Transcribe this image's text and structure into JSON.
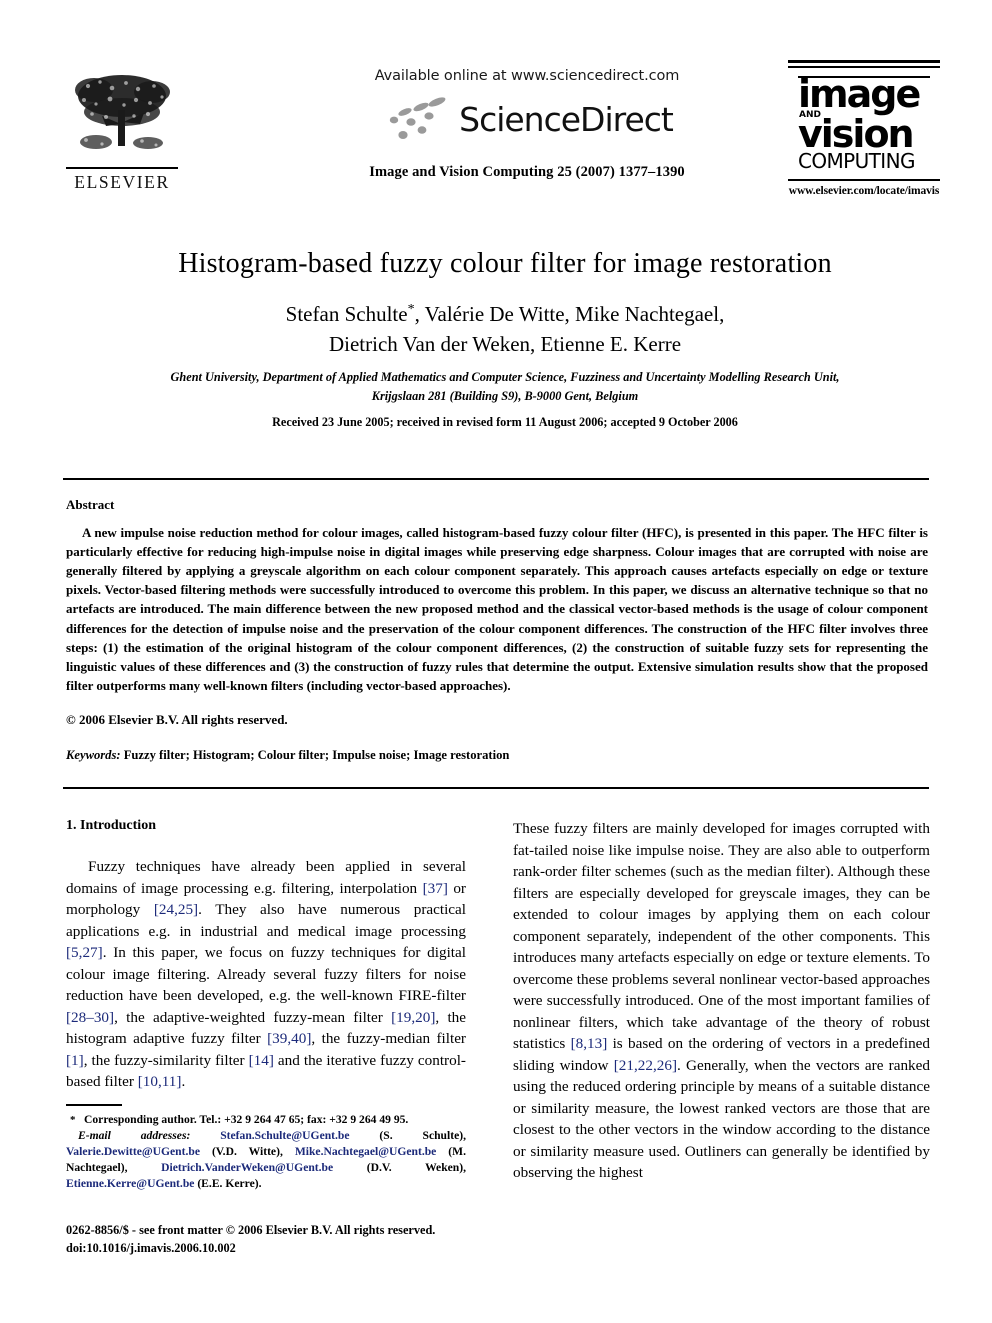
{
  "header": {
    "elsevier_logo_label": "ELSEVIER",
    "available_online": "Available online at www.sciencedirect.com",
    "sciencedirect_wordmark": "ScienceDirect",
    "journal_reference": "Image and Vision Computing 25 (2007) 1377–1390",
    "journal_logo": {
      "line1": "image",
      "line2": "AND",
      "line3": "vision",
      "line4": "COMPUTING"
    },
    "journal_url": "www.elsevier.com/locate/imavis"
  },
  "article": {
    "title": "Histogram-based fuzzy colour filter for image restoration",
    "authors_line1": "Stefan Schulte",
    "authors_line1_rest": ", Valérie De Witte, Mike Nachtegael,",
    "authors_line2": "Dietrich Van der Weken, Etienne E. Kerre",
    "corresponding_marker": "*",
    "affiliation_line1": "Ghent University, Department of Applied Mathematics and Computer Science, Fuzziness and Uncertainty Modelling Research Unit,",
    "affiliation_line2": "Krijgslaan 281 (Building S9), B-9000 Gent, Belgium",
    "history": "Received 23 June 2005; received in revised form 11 August 2006; accepted 9 October 2006"
  },
  "abstract": {
    "heading": "Abstract",
    "body": "A new impulse noise reduction method for colour images, called histogram-based fuzzy colour filter (HFC), is presented in this paper. The HFC filter is particularly effective for reducing high-impulse noise in digital images while preserving edge sharpness. Colour images that are corrupted with noise are generally filtered by applying a greyscale algorithm on each colour component separately. This approach causes artefacts especially on edge or texture pixels. Vector-based filtering methods were successfully introduced to overcome this problem. In this paper, we discuss an alternative technique so that no artefacts are introduced. The main difference between the new proposed method and the classical vector-based methods is the usage of colour component differences for the detection of impulse noise and the preservation of the colour component differences. The construction of the HFC filter involves three steps: (1) the estimation of the original histogram of the colour component differences, (2) the construction of suitable fuzzy sets for representing the linguistic values of these differences and (3) the construction of fuzzy rules that determine the output. Extensive simulation results show that the proposed filter outperforms many well-known filters (including vector-based approaches).",
    "copyright": "© 2006 Elsevier B.V. All rights reserved.",
    "keywords_label": "Keywords:",
    "keywords_value": "Fuzzy filter; Histogram; Colour filter; Impulse noise; Image restoration"
  },
  "introduction": {
    "heading": "1. Introduction",
    "left_paragraph_parts": [
      {
        "t": "Fuzzy techniques have already been applied in several domains of image processing e.g. filtering, interpolation ",
        "link": false
      },
      {
        "t": "[37]",
        "link": true
      },
      {
        "t": " or morphology ",
        "link": false
      },
      {
        "t": "[24,25]",
        "link": true
      },
      {
        "t": ". They also have numerous practical applications e.g. in industrial and medical image processing ",
        "link": false
      },
      {
        "t": "[5,27]",
        "link": true
      },
      {
        "t": ". In this paper, we focus on fuzzy techniques for digital colour image filtering. Already several fuzzy filters for noise reduction have been developed, e.g. the well-known FIRE-filter ",
        "link": false
      },
      {
        "t": "[28–30]",
        "link": true
      },
      {
        "t": ", the adaptive-weighted fuzzy-mean filter ",
        "link": false
      },
      {
        "t": "[19,20]",
        "link": true
      },
      {
        "t": ", the histogram adaptive fuzzy filter ",
        "link": false
      },
      {
        "t": "[39,40]",
        "link": true
      },
      {
        "t": ", the fuzzy-median filter ",
        "link": false
      },
      {
        "t": "[1]",
        "link": true
      },
      {
        "t": ", the fuzzy-similarity filter ",
        "link": false
      },
      {
        "t": "[14]",
        "link": true
      },
      {
        "t": " and the iterative fuzzy control-based filter ",
        "link": false
      },
      {
        "t": "[10,11]",
        "link": true
      },
      {
        "t": ".",
        "link": false
      }
    ],
    "right_paragraph_parts": [
      {
        "t": "These fuzzy filters are mainly developed for images corrupted with fat-tailed noise like impulse noise. They are also able to outperform rank-order filter schemes (such as the median filter). Although these filters are especially developed for greyscale images, they can be extended to colour images by applying them on each colour component separately, independent of the other components. This introduces many artefacts especially on edge or texture elements. To overcome these problems several nonlinear vector-based approaches were successfully introduced. One of the most important families of nonlinear filters, which take advantage of the theory of robust statistics ",
        "link": false
      },
      {
        "t": "[8,13]",
        "link": true
      },
      {
        "t": " is based on the ordering of vectors in a predefined sliding window ",
        "link": false
      },
      {
        "t": "[21,22,26]",
        "link": true
      },
      {
        "t": ". Generally, when the vectors are ranked using the reduced ordering principle by means of a suitable distance or similarity measure, the lowest ranked vectors are those that are closest to the other vectors in the window according to the distance or similarity measure used. Outliners can generally be identified by observing the highest",
        "link": false
      }
    ]
  },
  "footnote": {
    "star": "*",
    "corresponding": "Corresponding author. Tel.: +32 9 264 47 65; fax: +32 9 264 49 95.",
    "email_label": "E-mail addresses:",
    "emails": [
      {
        "address": "Stefan.Schulte@UGent.be",
        "name": "(S. Schulte)"
      },
      {
        "address": "Valerie.Dewitte@UGent.be",
        "name": "(V.D. Witte)"
      },
      {
        "address": "Mike.Nachtegael@UGent.be",
        "name": "(M. Nachtegael)"
      },
      {
        "address": "Dietrich.VanderWeken@UGent.be",
        "name": "(D.V. Weken)"
      },
      {
        "address": "Etienne.Kerre@UGent.be",
        "name": "(E.E. Kerre)"
      }
    ]
  },
  "imprint": {
    "front_matter": "0262-8856/$ - see front matter © 2006 Elsevier B.V. All rights reserved.",
    "doi": "doi:10.1016/j.imavis.2006.10.002"
  },
  "colors": {
    "link": "#1c2a7a",
    "text": "#000000",
    "background": "#ffffff"
  }
}
